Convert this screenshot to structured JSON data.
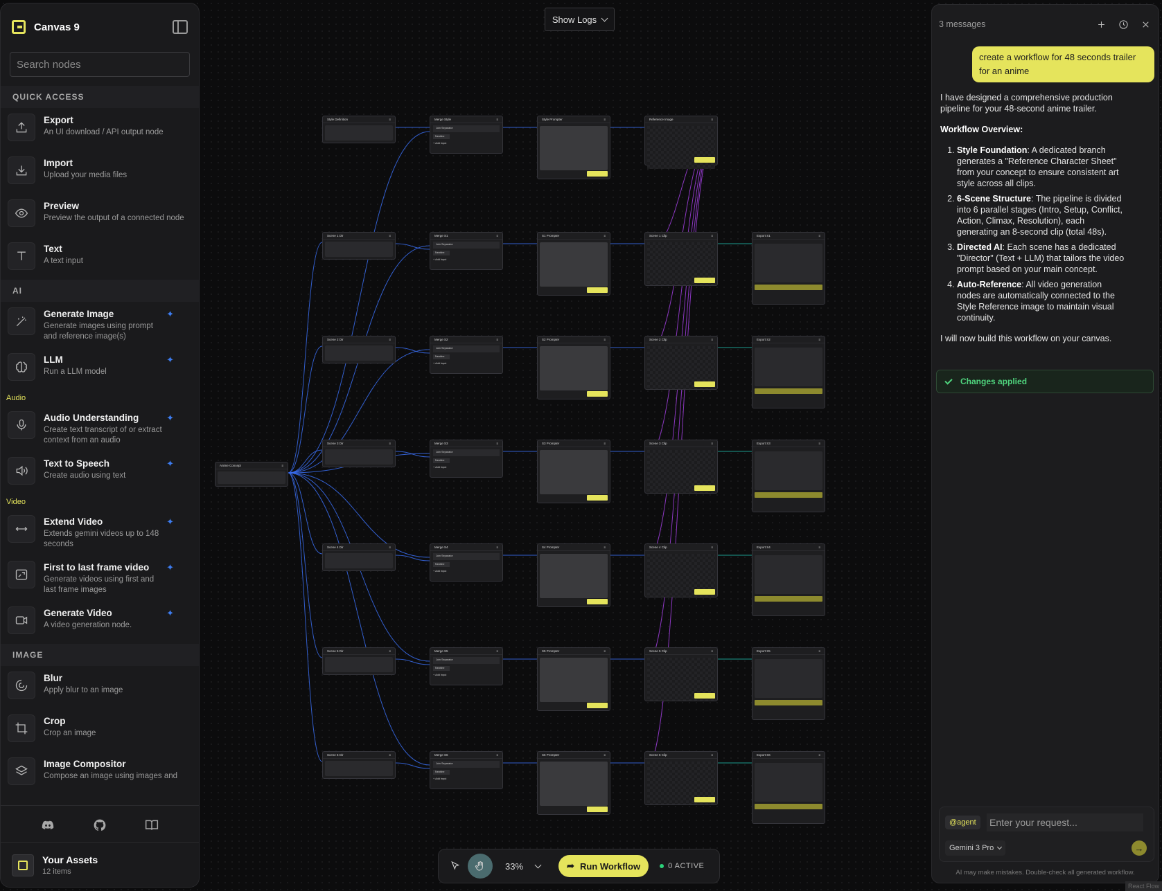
{
  "sidebar": {
    "title": "Canvas 9",
    "search_placeholder": "Search nodes",
    "sections": {
      "quick_access": "QUICK ACCESS",
      "ai": "AI",
      "audio": "Audio",
      "video": "Video",
      "image": "IMAGE"
    },
    "quick": [
      {
        "name": "Export",
        "desc": "An UI download / API output node",
        "icon": "upload-icon"
      },
      {
        "name": "Import",
        "desc": "Upload your media files",
        "icon": "download-icon"
      },
      {
        "name": "Preview",
        "desc": "Preview the output of a connected node",
        "icon": "eye-icon"
      },
      {
        "name": "Text",
        "desc": "A text input",
        "icon": "text-icon"
      }
    ],
    "ai_items": [
      {
        "name": "Generate Image",
        "desc": "Generate images using prompt and reference image(s)",
        "icon": "magic-wand-icon"
      },
      {
        "name": "LLM",
        "desc": "Run a LLM model",
        "icon": "brain-icon"
      }
    ],
    "audio_items": [
      {
        "name": "Audio Understanding",
        "desc": "Create text transcript of or extract context from an audio",
        "icon": "microphone-icon"
      },
      {
        "name": "Text to Speech",
        "desc": "Create audio using text",
        "icon": "speaker-icon"
      }
    ],
    "video_items": [
      {
        "name": "Extend Video",
        "desc": "Extends gemini videos up to 148 seconds",
        "icon": "arrows-horizontal-icon"
      },
      {
        "name": "First to last frame video",
        "desc": "Generate videos using first and last frame images",
        "icon": "frame-icon"
      },
      {
        "name": "Generate Video",
        "desc": "A video generation node.",
        "icon": "video-camera-icon"
      }
    ],
    "image_items": [
      {
        "name": "Blur",
        "desc": "Apply blur to an image",
        "icon": "blur-icon"
      },
      {
        "name": "Crop",
        "desc": "Crop an image",
        "icon": "crop-icon"
      },
      {
        "name": "Image Compositor",
        "desc": "Compose an image using images and",
        "icon": "layers-icon"
      }
    ],
    "assets": {
      "name": "Your Assets",
      "count": "12 items"
    }
  },
  "top": {
    "logs_label": "Show Logs"
  },
  "toolbar": {
    "zoom": "33%",
    "run_label": "Run Workflow",
    "active_label": "0 ACTIVE"
  },
  "chat": {
    "message_count": "3 messages",
    "user_message": "create a workflow for 48 seconds trailer for an anime",
    "assistant_intro": "I have designed a comprehensive production pipeline for your 48-second anime trailer.",
    "overview_heading": "Workflow Overview:",
    "points": [
      {
        "title": "Style Foundation",
        "text": ": A dedicated branch generates a \"Reference Character Sheet\" from your concept to ensure consistent art style across all clips."
      },
      {
        "title": "6-Scene Structure",
        "text": ": The pipeline is divided into 6 parallel stages (Intro, Setup, Conflict, Action, Climax, Resolution), each generating an 8-second clip (total 48s)."
      },
      {
        "title": "Directed AI",
        "text": ": Each scene has a dedicated \"Director\" (Text + LLM) that tailors the video prompt based on your main concept."
      },
      {
        "title": "Auto-Reference",
        "text": ": All video generation nodes are automatically connected to the Style Reference image to maintain visual continuity."
      }
    ],
    "closing": "I will now build this workflow on your canvas.",
    "changes_applied": "Changes applied",
    "agent_tag": "@agent",
    "input_placeholder": "Enter your request...",
    "model": "Gemini 3 Pro",
    "disclaimer": "AI may make mistakes. Double-check all generated workflow.",
    "watermark": "React Flow"
  },
  "graph": {
    "concept_title": "Anime Concept",
    "concept_text": "A cyberpunk anime about a hacker fighting AI gods",
    "style_title": "Style Definition",
    "merge_style": "Merge Style",
    "style_prompter": "Style Prompter",
    "reference_image": "Reference Image",
    "join_separator": "Join Separator",
    "newline": "Newline",
    "add_input": "+ Add Input",
    "add_reference": "+ Add Reference Image",
    "run_node": "Run Node",
    "download": "Download",
    "scenes": [
      {
        "dir": "Scene 1 Dir",
        "merge": "Merge S1",
        "prompter": "S1 Prompter",
        "clip": "Scene 1 Clip",
        "export": "Export S1"
      },
      {
        "dir": "Scene 2 Dir",
        "merge": "Merge S2",
        "prompter": "S2 Prompter",
        "clip": "Scene 2 Clip",
        "export": "Export S2"
      },
      {
        "dir": "Scene 3 Dir",
        "merge": "Merge S3",
        "prompter": "S3 Prompter",
        "clip": "Scene 3 Clip",
        "export": "Export S3"
      },
      {
        "dir": "Scene 4 Dir",
        "merge": "Merge S4",
        "prompter": "S4 Prompter",
        "clip": "Scene 4 Clip",
        "export": "Export S4"
      },
      {
        "dir": "Scene 5 Dir",
        "merge": "Merge S5",
        "prompter": "S5 Prompter",
        "clip": "Scene 5 Clip",
        "export": "Export S5"
      },
      {
        "dir": "Scene 6 Dir",
        "merge": "Merge S6",
        "prompter": "S6 Prompter",
        "clip": "Scene 6 Clip",
        "export": "Export S6"
      }
    ]
  },
  "colors": {
    "accent": "#e5e45c",
    "edge_blue": "#3a6df0",
    "edge_purple": "#a23fe0",
    "edge_teal": "#1fb5a8",
    "success": "#4fd47d"
  }
}
